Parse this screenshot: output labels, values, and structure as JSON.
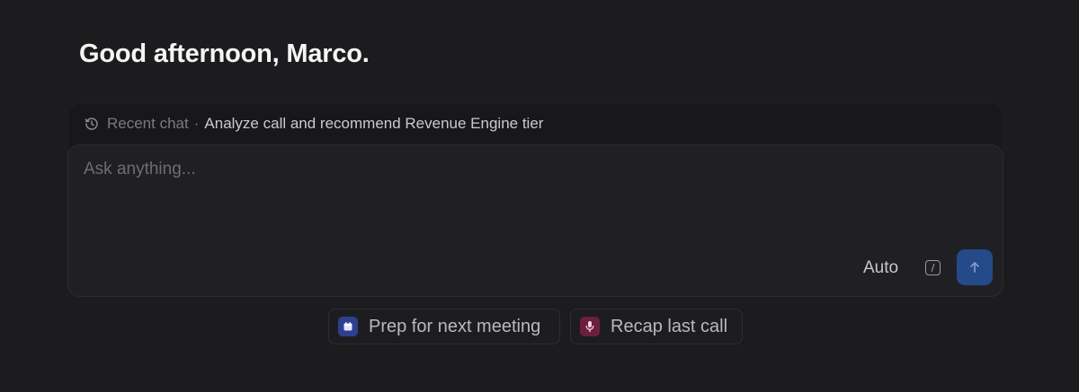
{
  "greeting": "Good afternoon, Marco.",
  "recent_chat": {
    "label": "Recent chat",
    "separator": "·",
    "title": "Analyze call and recommend Revenue Engine tier",
    "icon": "history-icon"
  },
  "composer": {
    "placeholder": "Ask anything...",
    "value": "",
    "model_label": "Auto",
    "slash_label": "/",
    "send_icon": "arrow-up-icon",
    "send_color": "#254a8a"
  },
  "suggestions": [
    {
      "label": "Prep for next meeting",
      "icon": "calendar-icon",
      "icon_bg": "#2f3f8f"
    },
    {
      "label": "Recap last call",
      "icon": "microphone-icon",
      "icon_bg": "#6b1f3a"
    }
  ]
}
